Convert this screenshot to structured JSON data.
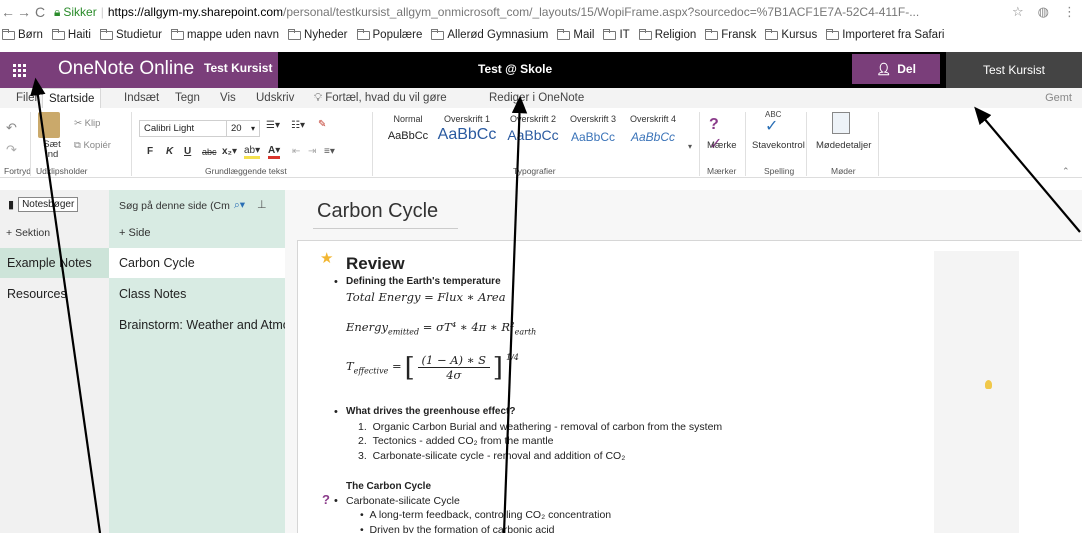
{
  "browser": {
    "secure_label": "Sikker",
    "url_host": "https://allgym-my.sharepoint.com",
    "url_path": "/personal/testkursist_allgym_onmicrosoft_com/_layouts/15/WopiFrame.aspx?sourcedoc=%7B1ACF1E7A-52C4-411F-..."
  },
  "bookmarks": [
    "Børn",
    "Haiti",
    "Studietur",
    "mappe uden navn",
    "Nyheder",
    "Populære",
    "Allerød Gymnasium",
    "Mail",
    "IT",
    "Religion",
    "Fransk",
    "Kursus",
    "Importeret fra Safari"
  ],
  "suite": {
    "app_name": "OneNote Online",
    "user_short": "Test Kursist",
    "doc_title": "Test @ Skole",
    "share_label": "Del",
    "user_name": "Test Kursist"
  },
  "tabs": {
    "items": [
      "Filer",
      "Startside",
      "Indsæt",
      "Tegn",
      "Vis",
      "Udskriv"
    ],
    "tell_me": "Fortæl, hvad du vil gøre",
    "edit_in": "Rediger i OneNote",
    "saved": "Gemt"
  },
  "ribbon": {
    "cut": "Klip",
    "copy": "Kopiér",
    "paste": "Sæt ind",
    "font": "Calibri Light",
    "size": "20",
    "styles": [
      {
        "name": "Normal",
        "sample": "AaBbCc"
      },
      {
        "name": "Overskrift 1",
        "sample": "AaBbCc"
      },
      {
        "name": "Overskrift 2",
        "sample": "AaBbCc"
      },
      {
        "name": "Overskrift 3",
        "sample": "AaBbCc"
      },
      {
        "name": "Overskrift 4",
        "sample": "AaBbCc"
      }
    ],
    "tags": "Mærke",
    "spelling": "Stavekontrol",
    "meeting": "Mødedetaljer",
    "spell_abc": "ABC",
    "groups": {
      "undo": "Fortryd",
      "clipboard": "Udklipsholder",
      "basic_text": "Grundlæggende tekst",
      "styles": "Typografier",
      "tags": "Mærker",
      "spelling": "Spelling",
      "meetings": "Møder"
    }
  },
  "nav": {
    "notebooks": "Notesbøger",
    "add_section": "Sektion",
    "search_placeholder": "Søg på denne side (Cm",
    "add_page": "Side",
    "sections": [
      "Example Notes",
      "Resources"
    ],
    "pages": [
      "Carbon Cycle",
      "Class Notes",
      "Brainstorm: Weather and Atmos"
    ]
  },
  "note": {
    "title": "Carbon Cycle",
    "heading": "Review",
    "b1": "Defining the Earth's temperature",
    "eq1": "Total Energy = Flux ∗ Area",
    "eq2": "Energy",
    "eq2_sub": "emitted",
    "eq2_rest": " = σT⁴ ∗ 4π ∗ R²",
    "eq2_sub2": "earth",
    "eq3": "T",
    "eq3_sub": "effective",
    "eq3_num": "(1 − A) ∗ S",
    "eq3_den": "4σ",
    "eq3_exp": "1/4",
    "b2": "What drives the greenhouse effect?",
    "list": [
      "Organic Carbon Burial and weathering - removal of carbon from the system",
      "Tectonics - added CO₂ from the mantle",
      "Carbonate-silicate cycle - removal and addition of CO₂"
    ],
    "subheading": "The Carbon Cycle",
    "b3": "Carbonate-silicate Cycle",
    "sub1": "A long-term feedback, controlling CO₂ concentration",
    "sub2": "Driven by the formation of carbonic acid"
  }
}
